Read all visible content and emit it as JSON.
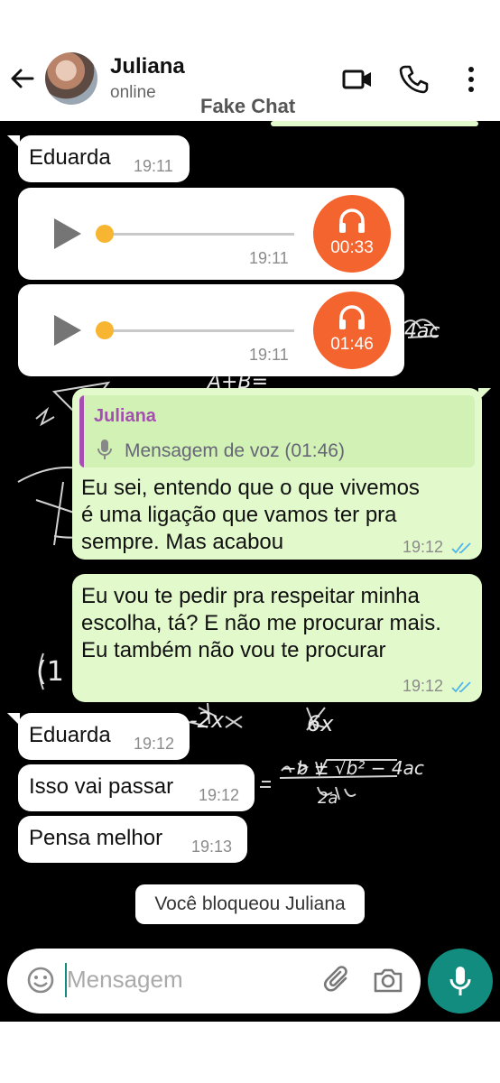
{
  "header": {
    "contact_name": "Juliana",
    "status": "online",
    "watermark": "Fake Chat",
    "icons": [
      "back-arrow-icon",
      "video-call-icon",
      "voice-call-icon",
      "more-options-icon"
    ]
  },
  "messages": [
    {
      "type": "text",
      "direction": "incoming",
      "text": "Eduarda",
      "time": "19:11"
    },
    {
      "type": "audio",
      "direction": "incoming",
      "duration": "00:33",
      "time": "19:11",
      "progress": 0
    },
    {
      "type": "audio",
      "direction": "incoming",
      "duration": "01:46",
      "time": "19:11",
      "progress": 0
    },
    {
      "type": "reply",
      "direction": "outgoing",
      "quote": {
        "name": "Juliana",
        "text": "Mensagem de voz (01:46)"
      },
      "lines": [
        "Eu sei, entendo que o que vivemos",
        "é uma ligação que vamos ter pra",
        "sempre. Mas acabou"
      ],
      "time": "19:12",
      "read": true
    },
    {
      "type": "text",
      "direction": "outgoing",
      "lines": [
        "Eu vou te pedir pra respeitar minha",
        "escolha, tá? E não me procurar mais.",
        "Eu também não vou te procurar"
      ],
      "time": "19:12",
      "read": true
    },
    {
      "type": "text",
      "direction": "incoming",
      "text": "Eduarda",
      "time": "19:12"
    },
    {
      "type": "text",
      "direction": "incoming",
      "text": "Isso vai passar",
      "time": "19:12"
    },
    {
      "type": "text",
      "direction": "incoming",
      "text": "Pensa melhor",
      "time": "19:13"
    }
  ],
  "system_notice": "Você bloqueou Juliana",
  "composer": {
    "placeholder": "Mensagem"
  },
  "colors": {
    "incoming_bubble": "#ffffff",
    "outgoing_bubble": "#e2f9cb",
    "accent": "#128c7e",
    "audio_badge": "#f4642e",
    "read_ticks": "#4fb6ec",
    "quote_name": "#a64fb3"
  }
}
